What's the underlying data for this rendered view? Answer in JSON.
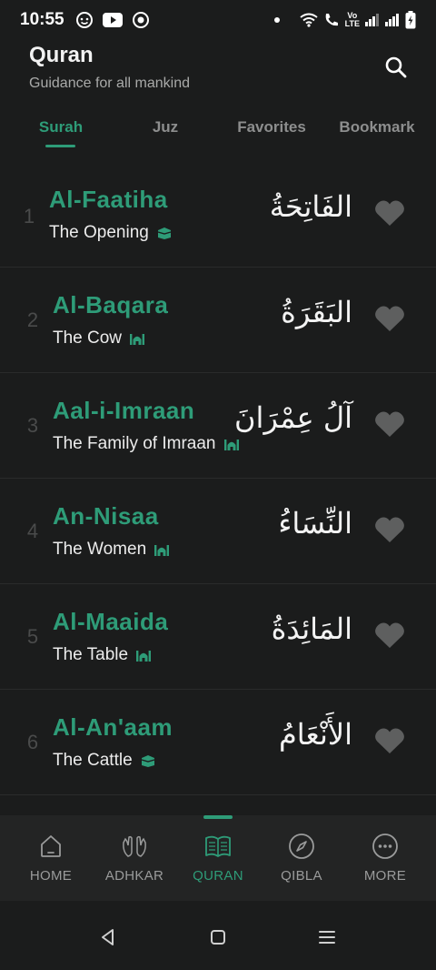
{
  "status_bar": {
    "time": "10:55",
    "left_icons": [
      "smiley-icon",
      "youtube-icon",
      "record-icon"
    ],
    "right_icons": [
      "dot-icon",
      "wifi-icon",
      "wifi-call-icon",
      "volte-icon",
      "signal-icon",
      "signal-icon",
      "battery-charging-icon"
    ],
    "volte_text": "Vo LTE2"
  },
  "header": {
    "title": "Quran",
    "subtitle": "Guidance for all mankind",
    "search_icon": "search-icon"
  },
  "tabs": [
    {
      "label": "Surah",
      "active": true
    },
    {
      "label": "Juz",
      "active": false
    },
    {
      "label": "Favorites",
      "active": false
    },
    {
      "label": "Bookmark",
      "active": false
    }
  ],
  "surahs": [
    {
      "number": "1",
      "name": "Al-Faatiha",
      "meaning": "The Opening",
      "arabic": "الفَاتِحَةُ",
      "revelation_icon": "kaaba-icon"
    },
    {
      "number": "2",
      "name": "Al-Baqara",
      "meaning": "The Cow",
      "arabic": "البَقَرَةُ",
      "revelation_icon": "mosque-icon"
    },
    {
      "number": "3",
      "name": "Aal-i-Imraan",
      "meaning": "The Family of Imraan",
      "arabic": "آلُ عِمْرَانَ",
      "revelation_icon": "mosque-icon"
    },
    {
      "number": "4",
      "name": "An-Nisaa",
      "meaning": "The Women",
      "arabic": "النِّسَاءُ",
      "revelation_icon": "mosque-icon"
    },
    {
      "number": "5",
      "name": "Al-Maaida",
      "meaning": "The Table",
      "arabic": "المَائِدَةُ",
      "revelation_icon": "mosque-icon"
    },
    {
      "number": "6",
      "name": "Al-An'aam",
      "meaning": "The Cattle",
      "arabic": "الأَنْعَامُ",
      "revelation_icon": "kaaba-icon"
    }
  ],
  "bottom_nav": [
    {
      "label": "HOME",
      "icon": "home-icon",
      "active": false
    },
    {
      "label": "ADHKAR",
      "icon": "praying-hands-icon",
      "active": false
    },
    {
      "label": "QURAN",
      "icon": "book-icon",
      "active": true
    },
    {
      "label": "QIBLA",
      "icon": "compass-icon",
      "active": false
    },
    {
      "label": "MORE",
      "icon": "more-icon",
      "active": false
    }
  ],
  "colors": {
    "accent": "#2e9c78",
    "background": "#1b1c1c",
    "favorite_icon": "#5e5f5f"
  }
}
